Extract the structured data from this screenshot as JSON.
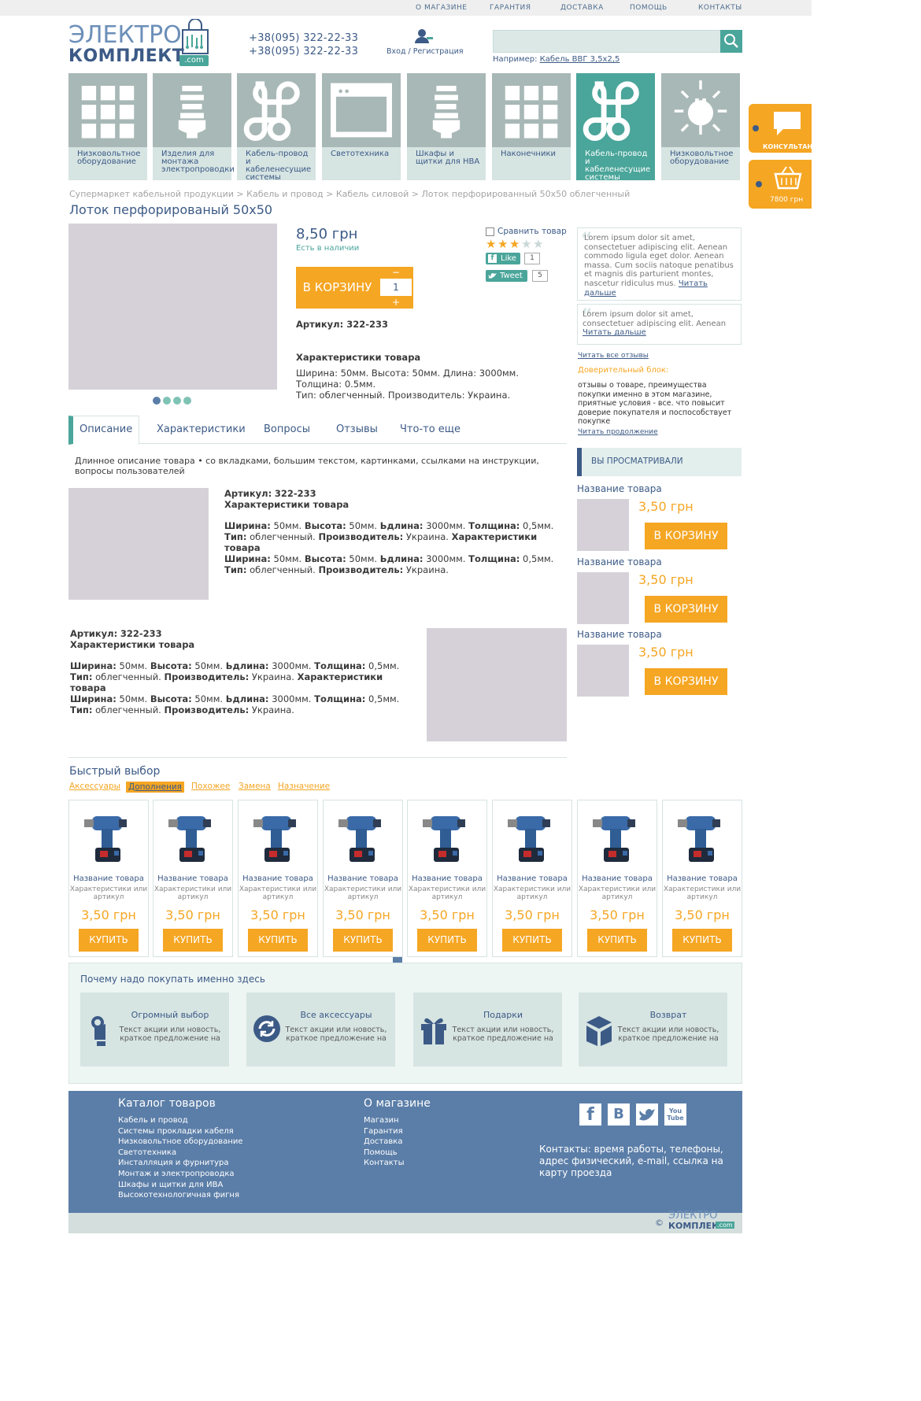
{
  "top_nav": [
    "О МАГАЗИНЕ",
    "ГАРАНТИЯ",
    "ДОСТАВКА",
    "ПОМОЩЬ",
    "КОНТАКТЫ"
  ],
  "logo": {
    "line1": "ЭЛЕКТРО",
    "line2": "КОМПЛЕКТ",
    "suffix": ".com"
  },
  "phones": [
    "+38(095) 322-22-33",
    "+38(095) 322-22-33"
  ],
  "login": {
    "login": "Вход",
    "sep": " / ",
    "register": "Регистрация"
  },
  "search": {
    "placeholder": "",
    "hint_label": "Например:",
    "hint_link": "Кабель ВВГ 3,5х2,5"
  },
  "categories": [
    {
      "label": "Низковольтное оборудование",
      "icon": "grid-icon"
    },
    {
      "label": "Изделия для монтажа электропроводки",
      "icon": "bulb-icon"
    },
    {
      "label": "Кабель-провод и кабеленесущие системы",
      "icon": "command-icon"
    },
    {
      "label": "Светотехника",
      "icon": "window-icon"
    },
    {
      "label": "Шкафы и щитки для НВА",
      "icon": "bulb-icon"
    },
    {
      "label": "Наконечники",
      "icon": "grid-icon"
    },
    {
      "label": "Кабель-провод и кабеленесущие системы",
      "icon": "command-icon",
      "active": true
    },
    {
      "label": "Низковольтное оборудование",
      "icon": "plug-icon"
    }
  ],
  "side_tabs": {
    "consultant": "КОНСУЛЬТАНТ",
    "cart": "7800 грн"
  },
  "breadcrumb": [
    "Супермаркет кабельной продукции",
    "Кабель и провод",
    "Кабель силовой",
    "Лоток перфорированный 50х50 облегченный"
  ],
  "product": {
    "title": "Лоток перфорированый 50х50",
    "price": "8,50 грн",
    "stock": "Есть в наличии",
    "cart_button": "В КОРЗИНУ",
    "qty": "1",
    "minus": "−",
    "plus": "+",
    "sku_label": "Артикул:",
    "sku": "322-233",
    "specs_title": "Характеристики товара",
    "specs": [
      "Ширина: 50мм. Высота: 50мм. Длина: 3000мм.",
      "Толщина: 0.5мм.",
      "Тип: облегченный. Производитель: Украина."
    ],
    "compare": "Сравнить товар",
    "rating": 3,
    "rating_max": 5,
    "like": "Like",
    "like_count": "1",
    "tweet": "Tweet",
    "tweet_count": "5"
  },
  "reviews": [
    {
      "text": "Lorem ipsum dolor sit amet, consectetuer adipiscing elit. Aenean commodo ligula eget dolor. Aenean massa. Cum sociis natoque penatibus et magnis dis parturient montes, nascetur ridiculus mus.",
      "more": "Читать дальше"
    },
    {
      "text": "Lorem ipsum dolor sit amet, consectetuer adipiscing elit. Aenean",
      "more": "Читать дальше"
    }
  ],
  "read_all": "Читать все отзывы",
  "trust": {
    "title": "Доверительный блок:",
    "text": "отзывы о товаре, преимущества покупки именно в этом магазине, приятные условия - все. что повысит доверие покупателя и поспособствует покупке",
    "more": "Читать продолжение"
  },
  "tabs": [
    "Описание",
    "Характеристики",
    "Вопросы",
    "Отзывы",
    "Что-то еще"
  ],
  "description": "Длинное описание товара • со вкладками, большим текстом, картинками, ссылками на инструкции, вопросы пользователей",
  "desc_block": {
    "sku_label": "Артикул:",
    "sku": "322-233",
    "specs_title": "Характеристики товара",
    "w_label": "Ширина:",
    "w": "50мм.",
    "h_label": "Высота:",
    "h": "50мм.",
    "l_label": "Ьдлина:",
    "l": "3000мм.",
    "t_label": "Толщина:",
    "t": "0,5мм.",
    "type_label": "Тип:",
    "type": "облегченный.",
    "maker_label": "Производитель:",
    "maker": "Украина."
  },
  "viewed": {
    "title": "ВЫ ПРОСМАТРИВАЛИ",
    "items": [
      {
        "name": "Название товара",
        "price": "3,50 грн",
        "button": "В КОРЗИНУ"
      },
      {
        "name": "Название товара",
        "price": "3,50 грн",
        "button": "В КОРЗИНУ"
      },
      {
        "name": "Название товара",
        "price": "3,50 грн",
        "button": "В КОРЗИНУ"
      }
    ]
  },
  "quick": {
    "title": "Быстрый выбор",
    "filters": [
      "Аксессуары",
      "Дополнения",
      "Похожее",
      "Замена",
      "Назначение"
    ],
    "active_filter": 1,
    "cards": [
      {
        "name": "Название товара",
        "desc": "Характеристики или артикул",
        "price": "3,50 грн",
        "button": "КУПИТЬ"
      },
      {
        "name": "Название товара",
        "desc": "Характеристики или артикул",
        "price": "3,50 грн",
        "button": "КУПИТЬ"
      },
      {
        "name": "Название товара",
        "desc": "Характеристики или артикул",
        "price": "3,50 грн",
        "button": "КУПИТЬ"
      },
      {
        "name": "Название товара",
        "desc": "Характеристики или артикул",
        "price": "3,50 грн",
        "button": "КУПИТЬ"
      },
      {
        "name": "Название товара",
        "desc": "Характеристики или артикул",
        "price": "3,50 грн",
        "button": "КУПИТЬ"
      },
      {
        "name": "Название товара",
        "desc": "Характеристики или артикул",
        "price": "3,50 грн",
        "button": "КУПИТЬ"
      },
      {
        "name": "Название товара",
        "desc": "Характеристики или артикул",
        "price": "3,50 грн",
        "button": "КУПИТЬ"
      },
      {
        "name": "Название товара",
        "desc": "Характеристики или артикул",
        "price": "3,50 грн",
        "button": "КУПИТЬ"
      }
    ]
  },
  "why": {
    "title": "Почему надо покупать именно здесь",
    "items": [
      {
        "title": "Огромный выбор",
        "text": "Текст акции или новость, краткое предложение на",
        "icon": "hand-ok-icon"
      },
      {
        "title": "Все аксессуары",
        "text": "Текст акции или новость, краткое предложение на",
        "icon": "refresh-icon"
      },
      {
        "title": "Подарки",
        "text": "Текст акции или новость, краткое предложение на",
        "icon": "gift-icon"
      },
      {
        "title": "Возврат",
        "text": "Текст акции или новость, краткое предложение на",
        "icon": "box-icon"
      }
    ]
  },
  "footer": {
    "catalog_title": "Каталог товаров",
    "catalog": [
      "Кабель и провод",
      "Системы прокладки кабеля",
      "Низковольтное оборудование",
      "Светотехника",
      "Инсталляция и фурнитура",
      "Монтаж и электропроводка",
      "Шкафы и щитки для ИВА",
      "Высокотехнологичная фигня"
    ],
    "about_title": "О магазине",
    "about": [
      "Магазин",
      "Гарантия",
      "Доставка",
      "Помощь",
      "Контакты"
    ],
    "social": [
      "f",
      "B",
      "t",
      "You Tube"
    ],
    "contacts": "Контакты: время работы, телефоны, адрес физический, e-mail, ссылка на карту проезда",
    "copyright": "©",
    "logo1": "ЭЛЕКТРО",
    "logo2": "КОМПЛЕКТ",
    "logo_suffix": ".com"
  },
  "colors": {
    "accent": "#4aa59a",
    "brand": "#3c5a86",
    "orange": "#f5a623",
    "footer": "#5b7ea8"
  }
}
